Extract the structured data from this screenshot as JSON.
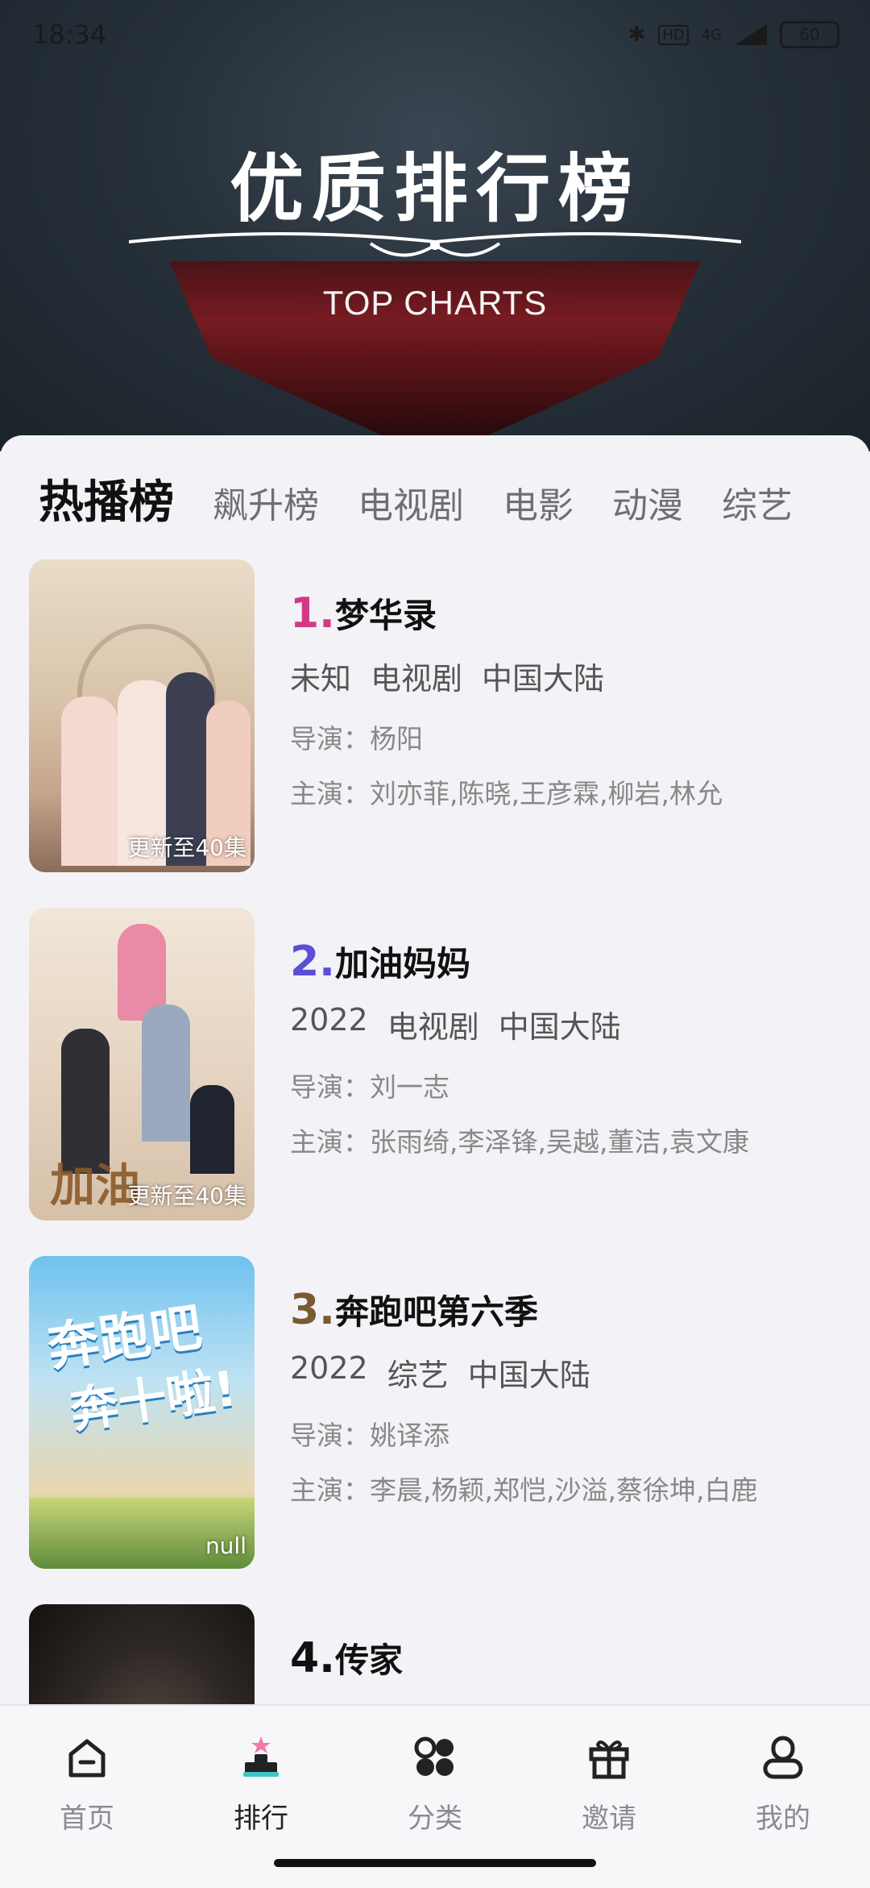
{
  "status_bar": {
    "time": "18:34",
    "network": "4G",
    "battery": "60",
    "hd": "HD"
  },
  "banner": {
    "title": "优质排行榜",
    "subtitle": "TOP CHARTS"
  },
  "tabs": [
    {
      "label": "热播榜",
      "active": true
    },
    {
      "label": "飙升榜",
      "active": false
    },
    {
      "label": "电视剧",
      "active": false
    },
    {
      "label": "电影",
      "active": false
    },
    {
      "label": "动漫",
      "active": false
    },
    {
      "label": "综艺",
      "active": false
    }
  ],
  "items": [
    {
      "rank": "1.",
      "rank_color": "#d23a86",
      "title": "梦华录",
      "year": "未知",
      "type": "电视剧",
      "region": "中国大陆",
      "director": "导演：杨阳",
      "cast": "主演：刘亦菲,陈晓,王彦霖,柳岩,林允",
      "badge": "更新至40集",
      "poster_colors": [
        "#e9dcc8",
        "#c9b29a",
        "#8a6c5a"
      ]
    },
    {
      "rank": "2.",
      "rank_color": "#5b4fd8",
      "title": "加油妈妈",
      "year": "2022",
      "type": "电视剧",
      "region": "中国大陆",
      "director": "导演：刘一志",
      "cast": "主演：张雨绮,李泽锋,吴越,董洁,袁文康",
      "badge": "更新至40集",
      "poster_colors": [
        "#efe2d2",
        "#d6c2ac",
        "#8a6f58"
      ]
    },
    {
      "rank": "3.",
      "rank_color": "#7a5a35",
      "title": "奔跑吧第六季",
      "year": "2022",
      "type": "综艺",
      "region": "中国大陆",
      "director": "导演：姚译添",
      "cast": "主演：李晨,杨颖,郑恺,沙溢,蔡徐坤,白鹿",
      "badge": "null",
      "poster_colors": [
        "#7ec7ef",
        "#cfe6f2",
        "#e7d6a6"
      ]
    },
    {
      "rank": "4.",
      "rank_color": "#111111",
      "title": "传家",
      "year": "",
      "type": "",
      "region": "",
      "director": "",
      "cast": "",
      "badge": "",
      "poster_colors": [
        "#3a332f",
        "#1f1b19",
        "#5a4d45"
      ]
    }
  ],
  "bottom_nav": [
    {
      "label": "首页",
      "icon": "home-icon",
      "active": false
    },
    {
      "label": "排行",
      "icon": "ranking-icon",
      "active": true
    },
    {
      "label": "分类",
      "icon": "category-icon",
      "active": false
    },
    {
      "label": "邀请",
      "icon": "gift-icon",
      "active": false
    },
    {
      "label": "我的",
      "icon": "profile-icon",
      "active": false
    }
  ]
}
